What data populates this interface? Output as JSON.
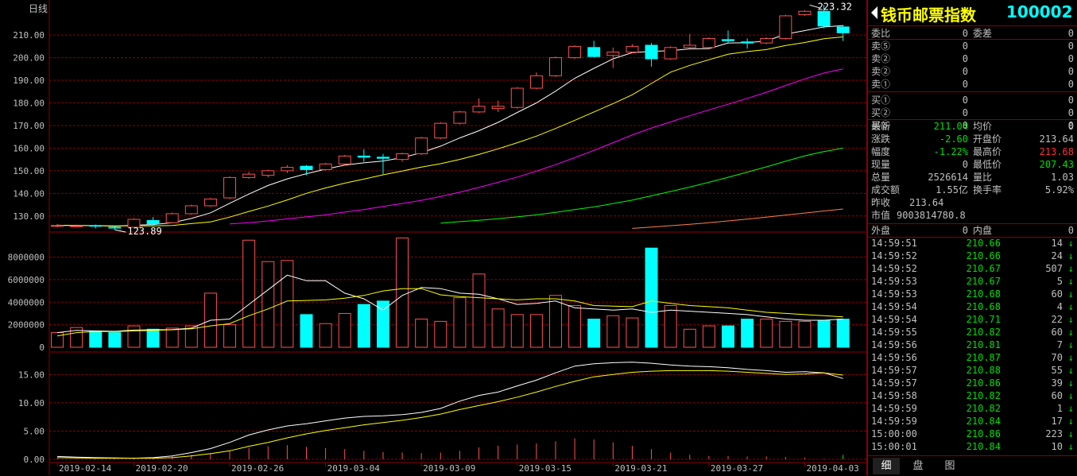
{
  "chart": {
    "period_label": "日线",
    "price_high_label": "223.32",
    "price_low_label": "123.89",
    "chart_data": [
      {
        "type": "candlestick",
        "price_ticks": [
          130,
          140,
          150,
          160,
          170,
          180,
          190,
          200,
          210
        ],
        "ylim": [
          125,
          222
        ],
        "x_tick_labels": [
          "2019-02-14",
          "2019-02-20",
          "2019-02-26",
          "2019-03-04",
          "2019-03-09",
          "2019-03-15",
          "2019-03-21",
          "2019-03-27",
          "2019-04-03"
        ],
        "x_tick_index": [
          0,
          4,
          9,
          14,
          19,
          24,
          29,
          34,
          39
        ],
        "candles": [
          {
            "o": 125.5,
            "h": 126.5,
            "l": 125.0,
            "c": 125.8,
            "up": true
          },
          {
            "o": 125.5,
            "h": 126.2,
            "l": 125.0,
            "c": 125.6,
            "up": true
          },
          {
            "o": 125.8,
            "h": 126.2,
            "l": 124.5,
            "c": 125.6,
            "up": false
          },
          {
            "o": 125.0,
            "h": 125.5,
            "l": 123.9,
            "c": 124.8,
            "up": false
          },
          {
            "o": 125.0,
            "h": 129.0,
            "l": 124.8,
            "c": 128.5,
            "up": true
          },
          {
            "o": 128.0,
            "h": 129.5,
            "l": 125.8,
            "c": 126.5,
            "up": false
          },
          {
            "o": 127.0,
            "h": 131.5,
            "l": 126.8,
            "c": 131.0,
            "up": true
          },
          {
            "o": 131.0,
            "h": 135.0,
            "l": 130.5,
            "c": 134.5,
            "up": true
          },
          {
            "o": 134.5,
            "h": 138.0,
            "l": 134.0,
            "c": 137.5,
            "up": true
          },
          {
            "o": 138.0,
            "h": 147.5,
            "l": 137.5,
            "c": 147.0,
            "up": true
          },
          {
            "o": 147.0,
            "h": 149.5,
            "l": 146.5,
            "c": 148.5,
            "up": true
          },
          {
            "o": 148.0,
            "h": 150.5,
            "l": 147.0,
            "c": 150.0,
            "up": true
          },
          {
            "o": 150.0,
            "h": 152.5,
            "l": 149.0,
            "c": 151.5,
            "up": true
          },
          {
            "o": 152.0,
            "h": 152.5,
            "l": 148.0,
            "c": 150.5,
            "up": false
          },
          {
            "o": 150.5,
            "h": 153.5,
            "l": 150.0,
            "c": 153.0,
            "up": true
          },
          {
            "o": 153.0,
            "h": 157.0,
            "l": 152.5,
            "c": 156.5,
            "up": true
          },
          {
            "o": 156.5,
            "h": 159.5,
            "l": 154.0,
            "c": 156.0,
            "up": false
          },
          {
            "o": 156.0,
            "h": 157.5,
            "l": 148.5,
            "c": 155.5,
            "up": false
          },
          {
            "o": 155.0,
            "h": 158.0,
            "l": 154.0,
            "c": 157.5,
            "up": true
          },
          {
            "o": 157.5,
            "h": 165.0,
            "l": 157.0,
            "c": 164.5,
            "up": true
          },
          {
            "o": 164.5,
            "h": 171.5,
            "l": 164.0,
            "c": 171.0,
            "up": true
          },
          {
            "o": 171.0,
            "h": 176.5,
            "l": 170.5,
            "c": 176.0,
            "up": true
          },
          {
            "o": 176.0,
            "h": 182.0,
            "l": 175.5,
            "c": 178.5,
            "up": true
          },
          {
            "o": 178.5,
            "h": 181.0,
            "l": 176.0,
            "c": 177.5,
            "up": true
          },
          {
            "o": 178.0,
            "h": 187.0,
            "l": 177.5,
            "c": 186.5,
            "up": true
          },
          {
            "o": 186.5,
            "h": 193.5,
            "l": 186.0,
            "c": 192.0,
            "up": true
          },
          {
            "o": 192.0,
            "h": 200.5,
            "l": 191.5,
            "c": 200.0,
            "up": true
          },
          {
            "o": 200.0,
            "h": 205.5,
            "l": 199.5,
            "c": 205.0,
            "up": true
          },
          {
            "o": 204.5,
            "h": 207.5,
            "l": 200.0,
            "c": 200.5,
            "up": false
          },
          {
            "o": 201.0,
            "h": 204.5,
            "l": 195.5,
            "c": 202.5,
            "up": true
          },
          {
            "o": 202.5,
            "h": 206.0,
            "l": 202.0,
            "c": 205.0,
            "up": true
          },
          {
            "o": 205.5,
            "h": 206.5,
            "l": 196.0,
            "c": 199.5,
            "up": false
          },
          {
            "o": 199.5,
            "h": 205.0,
            "l": 199.0,
            "c": 204.5,
            "up": true
          },
          {
            "o": 204.5,
            "h": 210.5,
            "l": 204.0,
            "c": 205.5,
            "up": true
          },
          {
            "o": 204.5,
            "h": 209.0,
            "l": 204.0,
            "c": 208.5,
            "up": true
          },
          {
            "o": 208.0,
            "h": 212.0,
            "l": 206.5,
            "c": 207.5,
            "up": false
          },
          {
            "o": 207.0,
            "h": 208.5,
            "l": 204.0,
            "c": 206.5,
            "up": false
          },
          {
            "o": 206.5,
            "h": 209.0,
            "l": 206.0,
            "c": 208.5,
            "up": true
          },
          {
            "o": 208.5,
            "h": 219.0,
            "l": 208.0,
            "c": 218.5,
            "up": true
          },
          {
            "o": 219.0,
            "h": 221.0,
            "l": 218.5,
            "c": 220.5,
            "up": true
          },
          {
            "o": 220.5,
            "h": 223.3,
            "l": 213.0,
            "c": 214.0,
            "up": false
          },
          {
            "o": 213.6,
            "h": 214.5,
            "l": 207.4,
            "c": 211.0,
            "up": false
          }
        ],
        "ma_lines": [
          {
            "color": "#ffffff",
            "values": [
              125.8,
              125.8,
              125.7,
              125.5,
              125.9,
              126.2,
              127.0,
              128.9,
              131.4,
              135.6,
              139.7,
              143.5,
              146.4,
              148.7,
              150.7,
              152.5,
              153.5,
              154.3,
              155.8,
              158.0,
              160.9,
              164.5,
              167.7,
              171.4,
              175.8,
              180.0,
              185.2,
              190.9,
              195.3,
              199.5,
              202.2,
              202.8,
              203.1,
              203.9,
              204.0,
              206.5,
              206.6,
              207.4,
              210.4,
              212.0,
              213.6,
              214.2
            ]
          },
          {
            "color": "#ffff00",
            "values": [
              125.9,
              125.8,
              125.7,
              125.6,
              125.6,
              125.6,
              125.8,
              126.6,
              127.4,
              129.5,
              132.0,
              134.4,
              137.1,
              140.0,
              142.4,
              144.5,
              146.3,
              148.2,
              149.9,
              151.6,
              153.1,
              155.0,
              157.2,
              159.7,
              162.4,
              165.3,
              168.7,
              172.3,
              176.0,
              179.7,
              183.6,
              188.6,
              193.6,
              196.6,
              199.1,
              201.5,
              202.7,
              203.6,
              205.4,
              206.7,
              208.4,
              209.2
            ]
          },
          {
            "color": "#ff00ff",
            "values": [
              null,
              null,
              null,
              null,
              null,
              null,
              null,
              null,
              null,
              126.5,
              127.0,
              127.8,
              128.7,
              129.6,
              130.5,
              131.7,
              132.8,
              134.2,
              135.5,
              136.9,
              138.6,
              140.5,
              142.6,
              144.9,
              147.2,
              149.8,
              152.7,
              155.8,
              159.0,
              162.4,
              165.8,
              168.9,
              171.6,
              174.3,
              176.9,
              179.4,
              182.0,
              184.7,
              187.7,
              190.6,
              193.2,
              195.0
            ]
          },
          {
            "color": "#00ff00",
            "values": [
              null,
              null,
              null,
              null,
              null,
              null,
              null,
              null,
              null,
              null,
              null,
              null,
              null,
              null,
              null,
              null,
              null,
              null,
              null,
              null,
              126.8,
              127.5,
              128.1,
              128.8,
              129.6,
              130.5,
              131.6,
              132.8,
              134.0,
              135.5,
              137.0,
              138.9,
              140.8,
              142.8,
              144.9,
              147.1,
              149.4,
              151.7,
              154.2,
              156.6,
              158.5,
              160.0
            ]
          },
          {
            "color": "#ff8040",
            "values": [
              null,
              null,
              null,
              null,
              null,
              null,
              null,
              null,
              null,
              null,
              null,
              null,
              null,
              null,
              null,
              null,
              null,
              null,
              null,
              null,
              null,
              null,
              null,
              null,
              null,
              null,
              null,
              null,
              null,
              null,
              124.5,
              125.1,
              125.7,
              126.3,
              127.0,
              127.8,
              128.6,
              129.5,
              130.4,
              131.3,
              132.2,
              133.1
            ]
          }
        ]
      },
      {
        "type": "bar",
        "name": "volume",
        "yticks": [
          0,
          2000000,
          4000000,
          6000000,
          8000000
        ],
        "ytick_labels": [
          "0",
          "2000000",
          "4000000",
          "6000000",
          "8000000"
        ],
        "ylim": [
          0,
          9800000
        ],
        "values": [
          1300000,
          1750000,
          1400000,
          1300000,
          1900000,
          1600000,
          1700000,
          1900000,
          4800000,
          2000000,
          9500000,
          7600000,
          7700000,
          2900000,
          2100000,
          3000000,
          3800000,
          4100000,
          9700000,
          2500000,
          2300000,
          4400000,
          6500000,
          3400000,
          2900000,
          2900000,
          4600000,
          3700000,
          2500000,
          2800000,
          2600000,
          8800000,
          3700000,
          1600000,
          1900000,
          1900000,
          2500000,
          2500000,
          2300000,
          2300000,
          2400000,
          2500000
        ],
        "ma_white": [
          1300000,
          1500000,
          1450000,
          1420000,
          1520000,
          1550000,
          1570000,
          1700000,
          2400000,
          2500000,
          3800000,
          5100000,
          6400000,
          5900000,
          5900000,
          4800000,
          4300000,
          3300000,
          4600000,
          5300000,
          5200000,
          4800000,
          4700000,
          4300000,
          3800000,
          3900000,
          4100000,
          3500000,
          3400000,
          3300000,
          3400000,
          3100000,
          3300000,
          3200000,
          3100000,
          3000000,
          2900000,
          2700000,
          2500000,
          2400000,
          2400000,
          2500000
        ],
        "ma_yellow": [
          1000000,
          1300000,
          1400000,
          1380000,
          1450000,
          1500000,
          1550000,
          1640000,
          1900000,
          2100000,
          2800000,
          3400000,
          4100000,
          4150000,
          4200000,
          4350000,
          4600000,
          5000000,
          5200000,
          5200000,
          4650000,
          4500000,
          4400000,
          4300000,
          4200000,
          4300000,
          4300000,
          4100000,
          3700000,
          3650000,
          3600000,
          4100000,
          3900000,
          3700000,
          3600000,
          3500000,
          3300000,
          3100000,
          3000000,
          2900000,
          2800000,
          2700000
        ]
      },
      {
        "type": "line",
        "name": "indicator",
        "yticks": [
          0,
          5,
          10,
          15
        ],
        "ytick_labels": [
          "0.00",
          "5.00",
          "10.00",
          "15.00"
        ],
        "ylim": [
          0,
          18
        ],
        "white": [
          0.5,
          0.4,
          0.3,
          0.25,
          0.2,
          0.3,
          0.6,
          1.2,
          1.9,
          3.0,
          4.3,
          5.2,
          5.9,
          6.3,
          6.8,
          7.3,
          7.6,
          7.7,
          7.9,
          8.3,
          9.0,
          10.3,
          11.3,
          11.9,
          13.0,
          14.0,
          15.3,
          16.5,
          16.9,
          17.1,
          17.2,
          17.0,
          16.7,
          16.5,
          16.4,
          16.2,
          15.9,
          15.7,
          15.4,
          15.5,
          15.3,
          14.3
        ],
        "yellow": [
          0.3,
          0.25,
          0.2,
          0.2,
          0.2,
          0.2,
          0.3,
          0.6,
          1.0,
          1.5,
          2.3,
          3.0,
          3.8,
          4.5,
          5.1,
          5.6,
          6.1,
          6.5,
          6.9,
          7.4,
          8.0,
          8.8,
          9.5,
          10.2,
          11.0,
          11.9,
          12.9,
          13.8,
          14.6,
          15.0,
          15.4,
          15.6,
          15.7,
          15.7,
          15.7,
          15.6,
          15.4,
          15.2,
          15.0,
          15.1,
          15.3,
          14.9
        ],
        "bars": [
          0.2,
          0.1,
          0.1,
          0.1,
          0.1,
          0.2,
          0.5,
          0.8,
          1.1,
          1.5,
          2.0,
          2.3,
          2.5,
          2.2,
          2.0,
          1.8,
          1.5,
          1.3,
          1.2,
          1.1,
          1.2,
          1.5,
          2.1,
          2.4,
          2.6,
          2.8,
          3.2,
          3.7,
          3.5,
          3.0,
          2.4,
          1.8,
          1.2,
          0.8,
          0.6,
          0.6,
          0.5,
          0.5,
          0.4,
          0.3,
          0.1,
          0.8
        ]
      }
    ]
  },
  "panel": {
    "title": "钱币邮票指数",
    "code": "100002",
    "order_rows": [
      {
        "l": "委比",
        "v1": "0",
        "l2": "委差",
        "v2": "0"
      },
      {
        "l": "卖⑤",
        "v1": "0",
        "v2": "0"
      },
      {
        "l": "卖②",
        "v1": "0",
        "v2": "0"
      },
      {
        "l": "卖②",
        "v1": "0",
        "v2": "0"
      },
      {
        "l": "卖①",
        "v1": "0",
        "v2": "0"
      },
      {
        "l": "买①",
        "v1": "0",
        "v2": "0"
      },
      {
        "l": "买②",
        "v1": "0",
        "v2": "0"
      },
      {
        "l": "买⑤",
        "v1": "0",
        "v2": "0"
      }
    ],
    "quote": {
      "latest_label": "最新",
      "latest": "211.04",
      "avg_label": "均价",
      "avg": "0",
      "change_label": "涨跌",
      "change": "-2.60",
      "open_label": "开盘价",
      "open": "213.64",
      "amp_label": "幅度",
      "amp": "-1.22%",
      "high_label": "最高价",
      "high": "213.68",
      "vol_label": "现量",
      "vol": "0",
      "low_label": "最低价",
      "low": "207.43",
      "total_label": "总量",
      "total": "2526614",
      "ratio_label": "量比",
      "ratio": "1.03",
      "amount_label": "成交额",
      "amount": "1.55亿",
      "turnover_label": "换手率",
      "turnover": "5.92%",
      "prev_label": "昨收",
      "prev": "213.64",
      "mcap_label": "市值",
      "mcap": "9003814780.8",
      "outer_label": "外盘",
      "outer": "0",
      "inner_label": "内盘",
      "inner": "0"
    },
    "ticks": [
      [
        "14:59:51",
        "210.66",
        "14"
      ],
      [
        "14:59:52",
        "210.66",
        "24"
      ],
      [
        "14:59:52",
        "210.67",
        "507"
      ],
      [
        "14:59:53",
        "210.67",
        "5"
      ],
      [
        "14:59:53",
        "210.68",
        "60"
      ],
      [
        "14:59:54",
        "210.68",
        "4"
      ],
      [
        "14:59:54",
        "210.71",
        "22"
      ],
      [
        "14:59:55",
        "210.82",
        "60"
      ],
      [
        "14:59:56",
        "210.81",
        "7"
      ],
      [
        "14:59:56",
        "210.87",
        "70"
      ],
      [
        "14:59:57",
        "210.88",
        "55"
      ],
      [
        "14:59:57",
        "210.86",
        "39"
      ],
      [
        "14:59:58",
        "210.82",
        "60"
      ],
      [
        "14:59:59",
        "210.82",
        "1"
      ],
      [
        "14:59:59",
        "210.84",
        "17"
      ],
      [
        "15:00:00",
        "210.86",
        "223"
      ],
      [
        "15:00:01",
        "210.84",
        "10"
      ]
    ],
    "tabs": [
      "细",
      "盘",
      "图"
    ],
    "colors": {
      "up": "#ff5050",
      "down": "#00ffff",
      "green": "#00e000",
      "grid": "#8b0000"
    }
  }
}
